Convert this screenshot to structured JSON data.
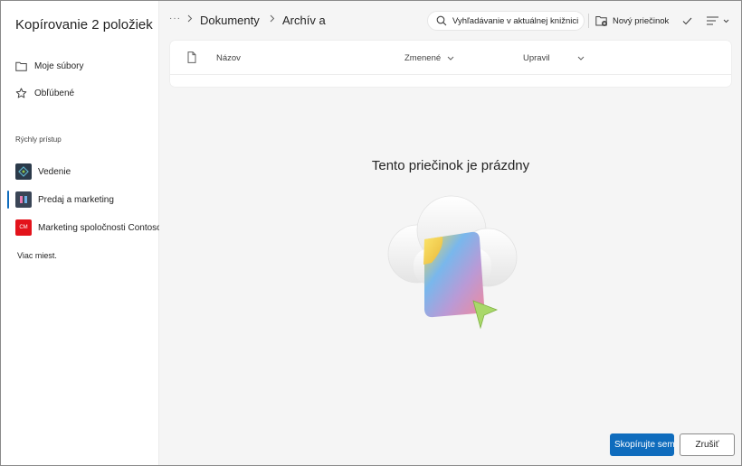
{
  "dialog": {
    "title": "Kopírovanie 2 položiek"
  },
  "sidebar": {
    "nav": [
      {
        "label": "Moje súbory",
        "icon": "folder-icon"
      },
      {
        "label": "Obľúbené",
        "icon": "star-icon"
      }
    ],
    "quick_access_label": "Rýchly prístup",
    "sites": [
      {
        "label": "Vedenie",
        "logo_color": "#2b3a4a",
        "active": false
      },
      {
        "label": "Predaj a marketing",
        "logo_color": "#3a4556",
        "active": true
      },
      {
        "label": "Marketing spoločnosti Contoso",
        "logo_color": "#e3131b",
        "logo_text": "CM",
        "active": false
      }
    ],
    "more_places": "Viac miest."
  },
  "topbar": {
    "ellipsis": "···",
    "breadcrumbs": [
      "Dokumenty",
      "Archív a"
    ],
    "search_placeholder": "Vyhľadávanie v aktuálnej knižnici",
    "new_folder_label": "Nový priečinok"
  },
  "list": {
    "columns": [
      "Názov",
      "Zmenené",
      "Upravil"
    ]
  },
  "empty_state": {
    "message": "Tento priečinok je prázdny"
  },
  "footer": {
    "primary_label": "Skopírujte sem",
    "cancel_label": "Zrušiť"
  },
  "colors": {
    "accent": "#0f6cbd",
    "main_bg": "#f5f5f5"
  }
}
